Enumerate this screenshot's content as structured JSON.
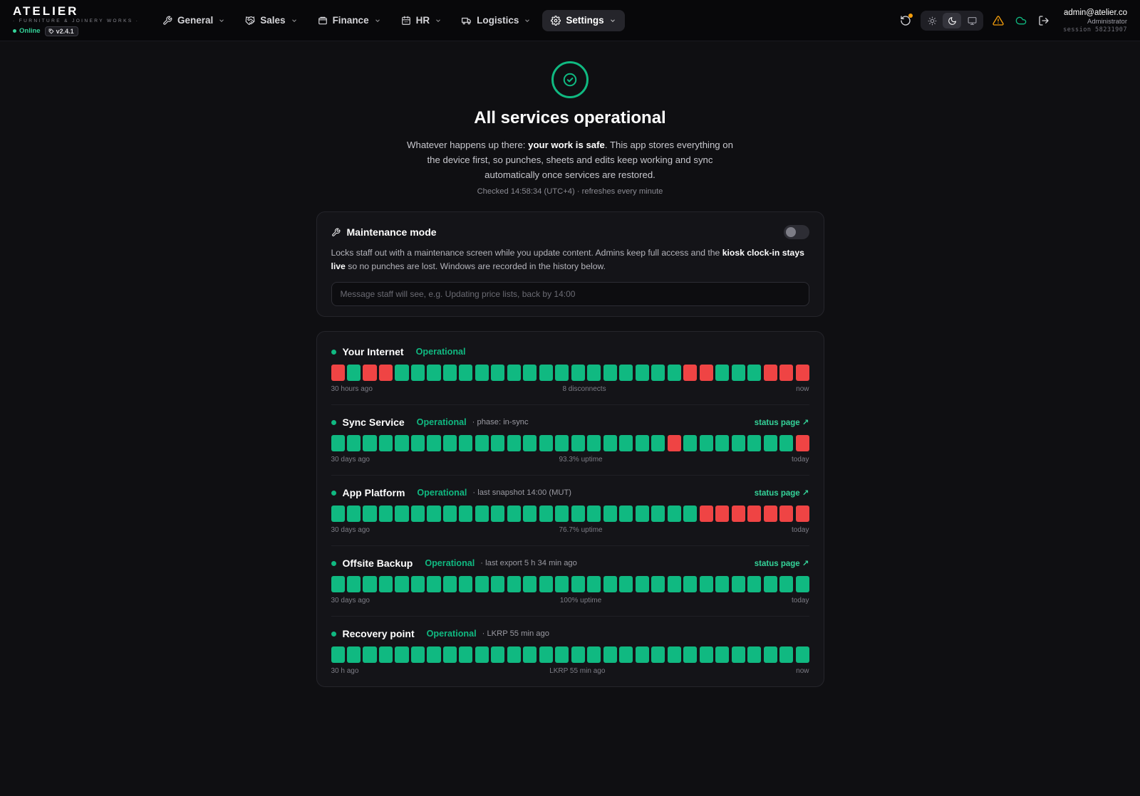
{
  "brand": {
    "name": "ATELIER",
    "subtitle": "· FURNITURE & JOINERY WORKS ·",
    "status": "Online",
    "version": "v2.4.1"
  },
  "nav": [
    {
      "label": "General",
      "icon": "wrench-icon"
    },
    {
      "label": "Sales",
      "icon": "handshake-icon"
    },
    {
      "label": "Finance",
      "icon": "wallet-icon"
    },
    {
      "label": "HR",
      "icon": "calendar-icon"
    },
    {
      "label": "Logistics",
      "icon": "truck-icon"
    },
    {
      "label": "Settings",
      "icon": "gear-icon",
      "active": true
    }
  ],
  "user": {
    "email": "admin@atelier.co",
    "role": "Administrator",
    "session": "session 58231907"
  },
  "theme": {
    "selected": "dark",
    "options": [
      "light",
      "dark",
      "system"
    ]
  },
  "colors": {
    "accent": "#10b981",
    "down": "#ef4444",
    "warning": "#f59e0b"
  },
  "hero": {
    "title": "All services operational",
    "desc_pre": "Whatever happens up there: ",
    "desc_bold": "your work is safe",
    "desc_post": ". This app stores everything on the device first, so punches, sheets and edits keep working and sync automatically once services are restored.",
    "checked": "Checked 14:58:34 (UTC+4) · refreshes every minute"
  },
  "maintenance": {
    "title": "Maintenance mode",
    "enabled": false,
    "desc_pre": "Locks staff out with a maintenance screen while you update content. Admins keep full access and the ",
    "desc_bold": "kiosk clock-in stays live",
    "desc_post": " so no punches are lost. Windows are recorded in the history below.",
    "placeholder": "Message staff will see, e.g. Updating price lists, back by 14:00",
    "value": ""
  },
  "services": [
    {
      "name": "Your Internet",
      "status": "Operational",
      "meta": "",
      "link": "",
      "history": [
        0,
        1,
        0,
        0,
        1,
        1,
        1,
        1,
        1,
        1,
        1,
        1,
        1,
        1,
        1,
        1,
        1,
        1,
        1,
        1,
        1,
        1,
        0,
        0,
        1,
        1,
        1,
        0,
        0,
        0
      ],
      "foot_left": "30 hours ago",
      "foot_center": "8 disconnects",
      "foot_right": "now"
    },
    {
      "name": "Sync Service",
      "status": "Operational",
      "meta": "· phase: in-sync",
      "link": "status page ↗",
      "history": [
        1,
        1,
        1,
        1,
        1,
        1,
        1,
        1,
        1,
        1,
        1,
        1,
        1,
        1,
        1,
        1,
        1,
        1,
        1,
        1,
        1,
        0,
        1,
        1,
        1,
        1,
        1,
        1,
        1,
        0
      ],
      "foot_left": "30 days ago",
      "foot_center": "93.3% uptime",
      "foot_right": "today"
    },
    {
      "name": "App Platform",
      "status": "Operational",
      "meta": "· last snapshot 14:00 (MUT)",
      "link": "status page ↗",
      "history": [
        1,
        1,
        1,
        1,
        1,
        1,
        1,
        1,
        1,
        1,
        1,
        1,
        1,
        1,
        1,
        1,
        1,
        1,
        1,
        1,
        1,
        1,
        1,
        0,
        0,
        0,
        0,
        0,
        0,
        0
      ],
      "foot_left": "30 days ago",
      "foot_center": "76.7% uptime",
      "foot_right": "today"
    },
    {
      "name": "Offsite Backup",
      "status": "Operational",
      "meta": "· last export 5 h 34 min ago",
      "link": "status page ↗",
      "history": [
        1,
        1,
        1,
        1,
        1,
        1,
        1,
        1,
        1,
        1,
        1,
        1,
        1,
        1,
        1,
        1,
        1,
        1,
        1,
        1,
        1,
        1,
        1,
        1,
        1,
        1,
        1,
        1,
        1,
        1
      ],
      "foot_left": "30 days ago",
      "foot_center": "100% uptime",
      "foot_right": "today"
    },
    {
      "name": "Recovery point",
      "status": "Operational",
      "meta": "· LKRP 55 min ago",
      "link": "",
      "history": [
        1,
        1,
        1,
        1,
        1,
        1,
        1,
        1,
        1,
        1,
        1,
        1,
        1,
        1,
        1,
        1,
        1,
        1,
        1,
        1,
        1,
        1,
        1,
        1,
        1,
        1,
        1,
        1,
        1,
        1
      ],
      "foot_left": "30 h ago",
      "foot_center": "LKRP 55 min ago",
      "foot_right": "now"
    }
  ]
}
